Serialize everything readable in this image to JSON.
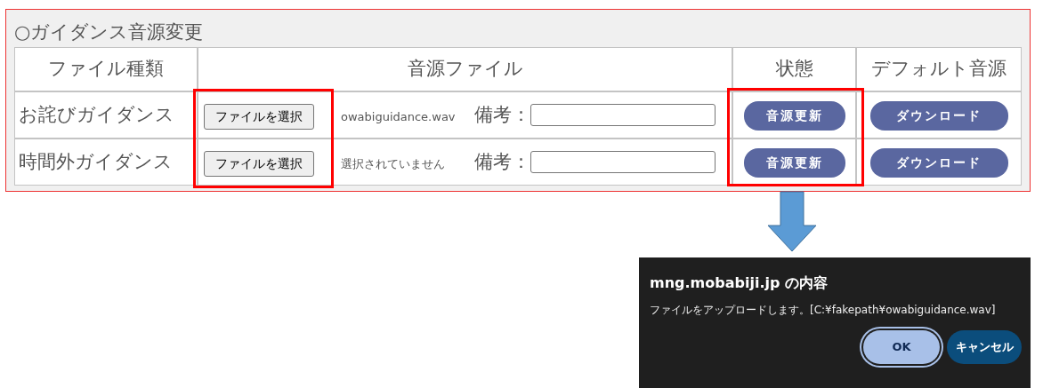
{
  "panel": {
    "title": "○ガイダンス音源変更"
  },
  "table": {
    "columns": [
      "ファイル種類",
      "音源ファイル",
      "状態",
      "デフォルト音源"
    ],
    "rows": [
      {
        "type": "お詫びガイダンス",
        "choose_button": "ファイルを選択",
        "file_name": "owabiguidance.wav",
        "note_label": "備考：",
        "update_button": "音源更新",
        "download_button": "ダウンロード"
      },
      {
        "type": "時間外ガイダンス",
        "choose_button": "ファイルを選択",
        "file_name": "選択されていません",
        "note_label": "備考：",
        "update_button": "音源更新",
        "download_button": "ダウンロード"
      }
    ]
  },
  "dialog": {
    "title": "mng.mobabiji.jp の内容",
    "message": "ファイルをアップロードします。[C:¥fakepath¥owabiguidance.wav]",
    "buttons": [
      {
        "label": "OK",
        "kind": "primary"
      },
      {
        "label": "キャンセル",
        "kind": "secondary"
      }
    ]
  }
}
